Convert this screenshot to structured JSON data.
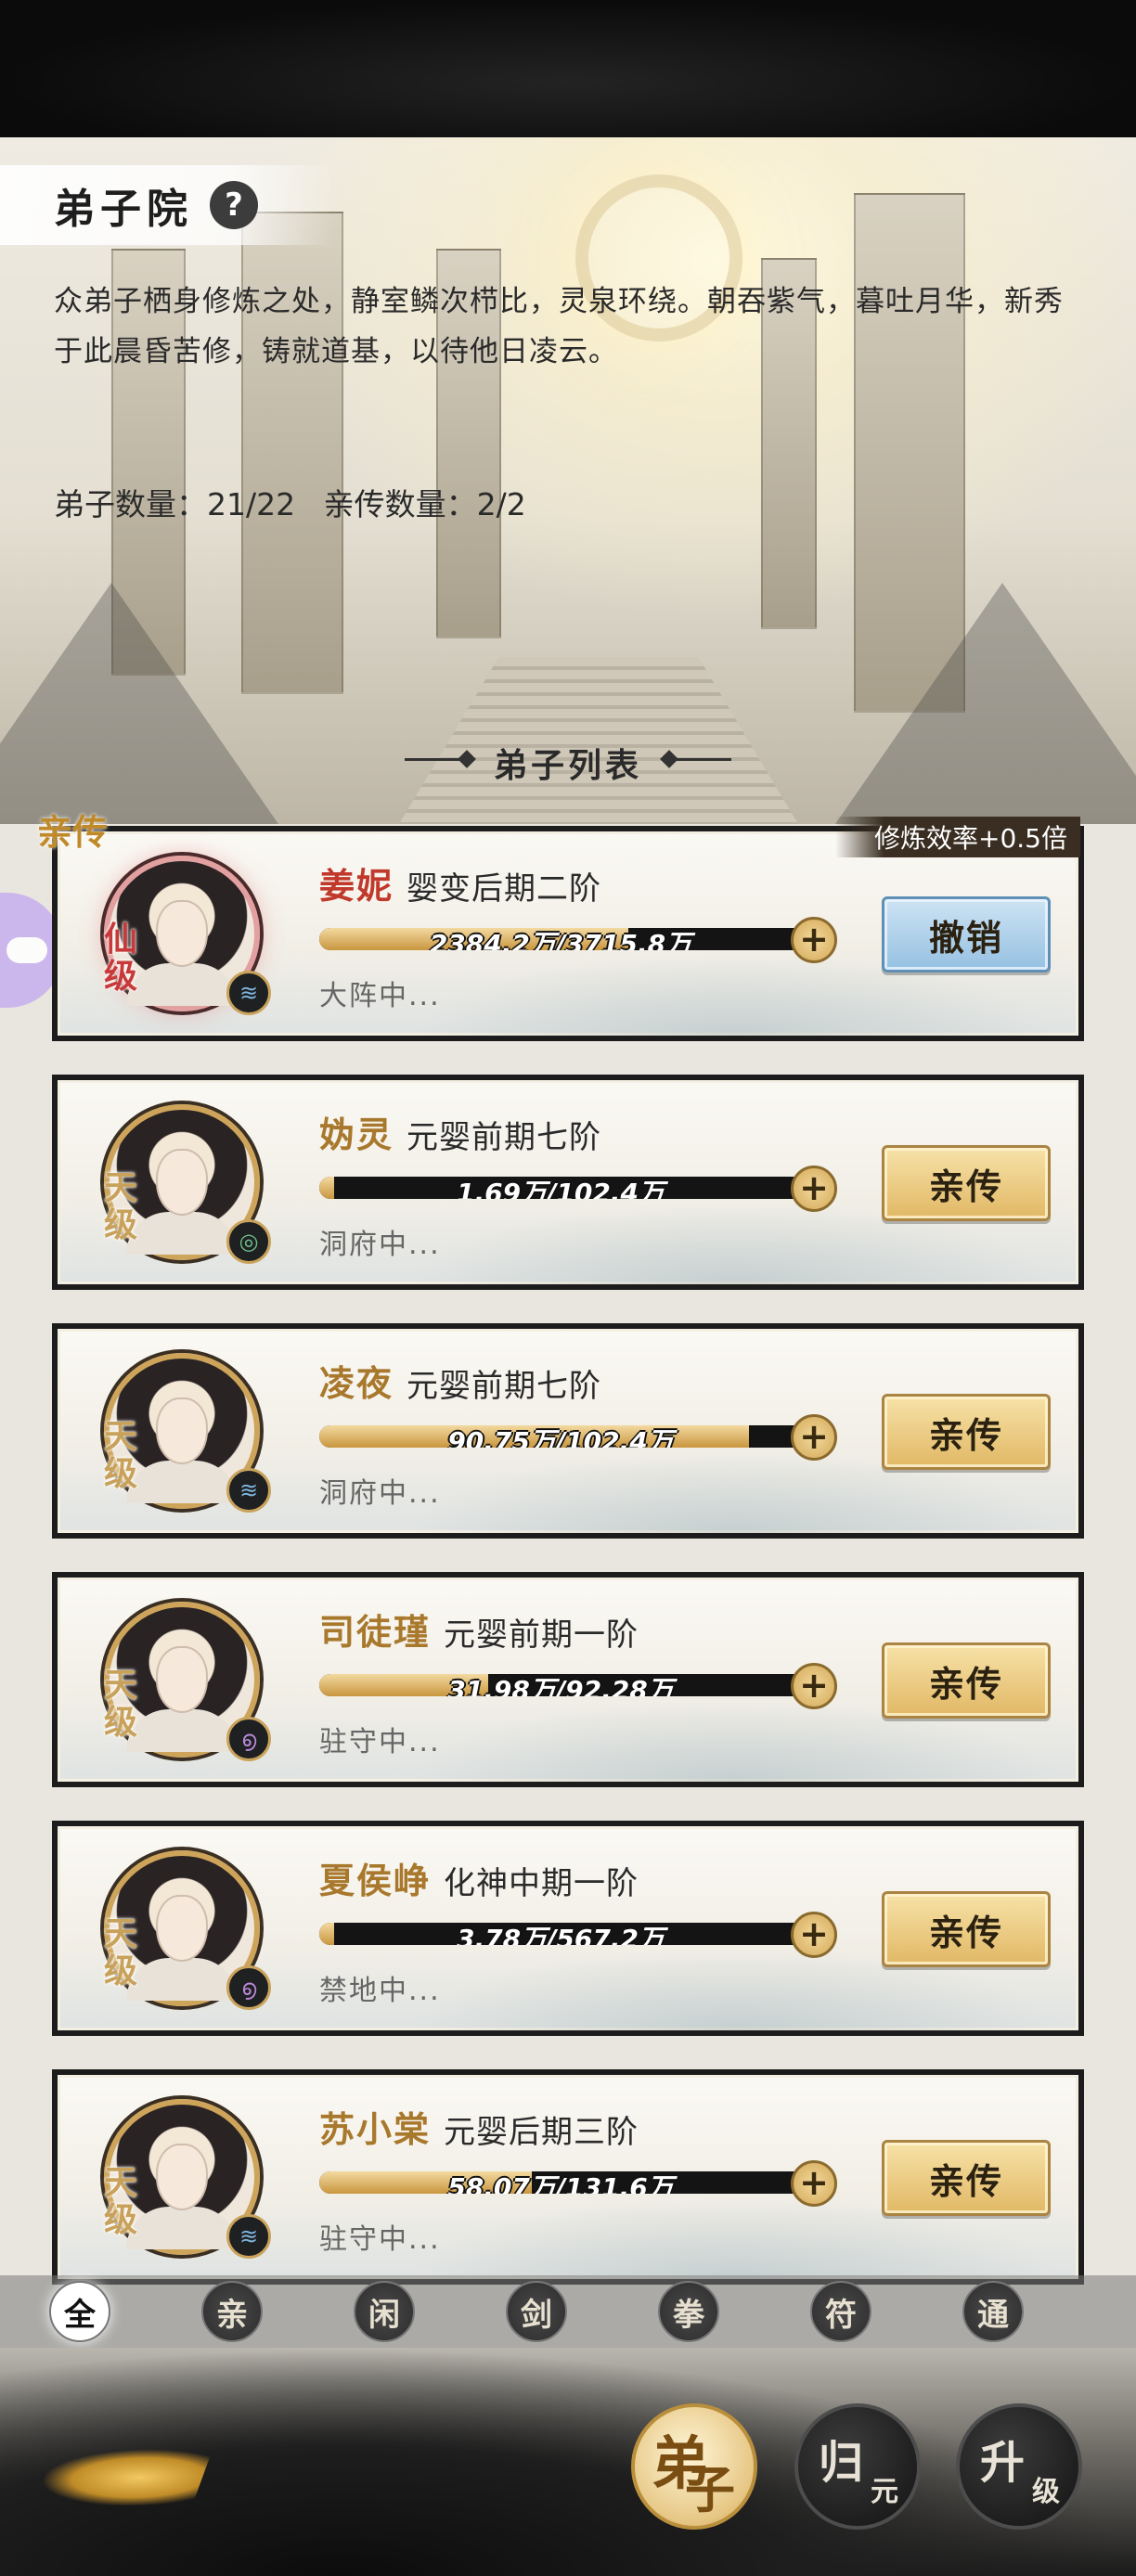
{
  "header": {
    "title": "弟子院",
    "help_icon": "?"
  },
  "description": "众弟子栖身修炼之处，静室鳞次栉比，灵泉环绕。朝吞紫气，暮吐月华，新秀于此晨昏苦修，铸就道基，以待他日凌云。",
  "counts": {
    "disciples": "弟子数量：21/22",
    "direct": "亲传数量：2/2"
  },
  "list_title": "弟子列表",
  "direct_tag": "亲传",
  "efficiency_badge": "修炼效率+0.5倍",
  "disciples": [
    {
      "name": "姜妮",
      "realm": "婴变后期二阶",
      "progress_text": "2384.2万/3715.8万",
      "progress": 0.64,
      "location": "大阵中...",
      "grade": "仙级",
      "element": "water",
      "action": "撤销"
    },
    {
      "name": "妫灵",
      "realm": "元婴前期七阶",
      "progress_text": "1.69万/102.4万",
      "progress": 0.02,
      "location": "洞府中...",
      "grade": "天级",
      "element": "wind",
      "action": "亲传"
    },
    {
      "name": "凌夜",
      "realm": "元婴前期七阶",
      "progress_text": "90.75万/102.4万",
      "progress": 0.89,
      "location": "洞府中...",
      "grade": "天级",
      "element": "water",
      "action": "亲传"
    },
    {
      "name": "司徒瑾",
      "realm": "元婴前期一阶",
      "progress_text": "31.98万/92.28万",
      "progress": 0.35,
      "location": "驻守中...",
      "grade": "天级",
      "element": "spirit",
      "action": "亲传"
    },
    {
      "name": "夏侯峥",
      "realm": "化神中期一阶",
      "progress_text": "3.78万/567.2万",
      "progress": 0.01,
      "location": "禁地中...",
      "grade": "天级",
      "element": "spirit",
      "action": "亲传"
    },
    {
      "name": "苏小棠",
      "realm": "元婴后期三阶",
      "progress_text": "58.07万/131.6万",
      "progress": 0.44,
      "location": "驻守中...",
      "grade": "天级",
      "element": "water",
      "action": "亲传"
    }
  ],
  "plus_label": "+",
  "filters": [
    "全",
    "亲",
    "闲",
    "剑",
    "拳",
    "符",
    "通"
  ],
  "nav": [
    {
      "big": "弟",
      "small": "子"
    },
    {
      "big": "归",
      "small": "元"
    },
    {
      "big": "升",
      "small": "级"
    }
  ]
}
